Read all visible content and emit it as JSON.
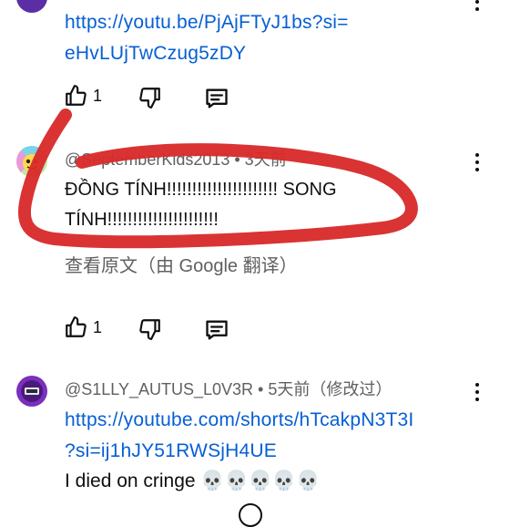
{
  "comments": [
    {
      "link_line1": "https://youtu.be/PjAjFTyJ1bs?si=",
      "link_line2": "eHvLUjTwCzug5zDY",
      "likes": "1"
    },
    {
      "meta": "@SeptemberKids2013 • 3天前",
      "text_line1": "ĐỒNG TÍNH!!!!!!!!!!!!!!!!!!!!!! SONG",
      "text_line2": "TÍNH!!!!!!!!!!!!!!!!!!!!!!",
      "translate_label": "查看原文（由 Google 翻译）",
      "likes": "1"
    },
    {
      "meta": "@S1LLY_AUTUS_L0V3R • 5天前（修改过）",
      "link_line1": "https://youtube.com/shorts/hTcakpN3T3I",
      "link_line2": "?si=ij1hJY51RWSjH4UE",
      "text": "I died on cringe 💀💀💀💀💀"
    }
  ],
  "icons": {
    "like": "thumb-up-icon",
    "dislike": "thumb-down-icon",
    "reply": "reply-icon",
    "more": "more-vert-icon"
  },
  "colors": {
    "link": "#065fd4",
    "annotation": "#d92b2b"
  }
}
